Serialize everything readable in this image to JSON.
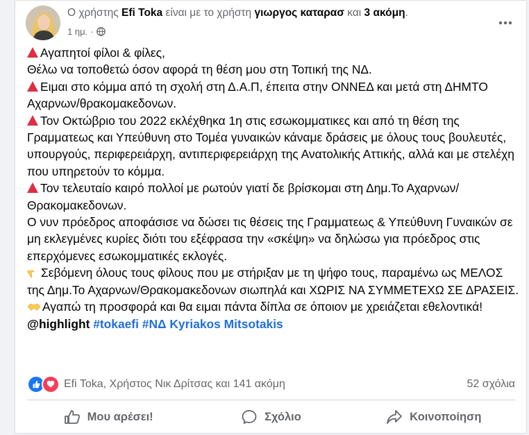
{
  "post": {
    "header": {
      "prefix": "Ο χρήστης",
      "author": "Efi Toka",
      "with_text": "είναι με το χρήστη",
      "tagged": "γιωργος καταρασ",
      "and_text": "και",
      "others": "3 ακόμη",
      "period": "."
    },
    "time": "1 ημ.",
    "audience_icon": "globe-icon",
    "body": [
      {
        "icon": "red-triangle-icon",
        "text": "Αγαπητοί φίλοι & φίλες,"
      },
      {
        "icon": "",
        "text": "Θέλω να τοποθετώ όσον αφορά τη θέση μου στη Τοπική της ΝΔ."
      },
      {
        "icon": "red-triangle-icon",
        "text": "Ειμαι στο κόμμα από τη σχολή στη Δ.Α.Π, έπειτα στην ΟΝΝΕΔ και μετά στη ΔΗΜΤΟ Αχαρνων/θρακομακεδονων."
      },
      {
        "icon": "red-triangle-icon",
        "text": "Τον Οκτώβριο του 2022 εκλέχθηκα 1η στις εσωκομματικες και από τη θέση της Γραμματεως και Υπεύθυνη στο Τομέα γυναικών κάναμε δράσεις με όλους τους βουλευτές, υπουργούς, περιφερειάρχη, αντιπεριφερειάρχη της Ανατολικής Αττικής, αλλά και με στελέχη που υπηρετούν το κόμμα."
      },
      {
        "icon": "red-triangle-icon",
        "text": "Τον τελευταίο καιρό πολλοί με ρωτούν γιατί δε βρίσκομαι στη Δημ.Το Αχαρνων/ Θρακομακεδονων."
      },
      {
        "icon": "",
        "text": "Ο νυν πρόεδρος αποφάσισε να δώσει τις θέσεις της Γραμματεως & Υπεύθυνη Γυναικών σε μη εκλεγμένες κυρίες διότι του εξέφρασα την «σκέψη» να δηλώσω για πρόεδρος στις επερχόμενες εσωκομματικές εκλογές."
      },
      {
        "icon": "pointing-hand-icon",
        "text": "Σεβόμενη όλους τους φίλους που με στήριξαν με τη ψήφο τους, παραμένω  ως ΜΕΛΟΣ της Δημ.Το Αχαρνων/Θρακομακεδονων σιωπηλά και ΧΩΡΙΣ ΝΑ ΣΥΜΜΕΤΕΧΩ ΣΕ ΔΡΑΣΕΙΣ."
      },
      {
        "icon": "handshake-icon",
        "text": "Αγαπώ τη προσφορά και θα ειμαι πάντα δίπλα σε όποιον με χρειάζεται εθελοντικά!"
      }
    ],
    "mention": "@highlight",
    "hashtags": [
      "#tokaefi",
      "#ΝΔ",
      "Kyriakos Mitsotakis"
    ],
    "reactions_text": "Efi Toka, Χρήστος Νικ Δρίτσας και 141 ακόμη",
    "comments_count": "52 σχόλια",
    "actions": {
      "like": "Μου αρέσει!",
      "comment": "Σχόλιο",
      "share": "Κοινοποίηση"
    }
  },
  "colors": {
    "link_blue": "#216fdb",
    "like_blue": "#1877f2",
    "love_red": "#f33e58",
    "secondary_text": "#65676b"
  }
}
